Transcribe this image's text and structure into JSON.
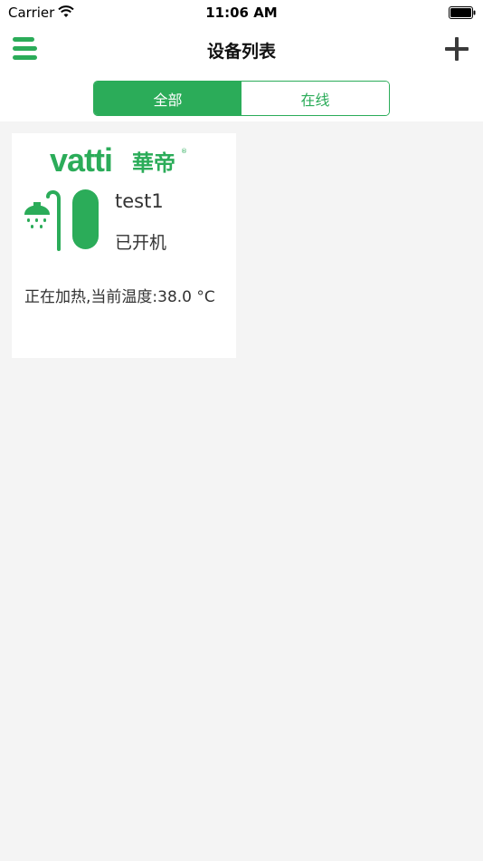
{
  "status_bar": {
    "carrier": "Carrier",
    "time": "11:06 AM"
  },
  "nav": {
    "title": "设备列表",
    "menu_icon": "menu-icon",
    "add_icon": "plus-icon"
  },
  "tabs": [
    {
      "label": "全部",
      "selected": true
    },
    {
      "label": "在线",
      "selected": false
    }
  ],
  "devices": [
    {
      "brand_logo_text": "vatti 華帝",
      "icon": "water-heater-icon",
      "name": "test1",
      "power_state": "已开机",
      "status_text": "正在加热,当前温度:38.0 °C"
    }
  ],
  "colors": {
    "accent": "#2bac59",
    "background": "#f4f4f4",
    "card": "#ffffff"
  }
}
